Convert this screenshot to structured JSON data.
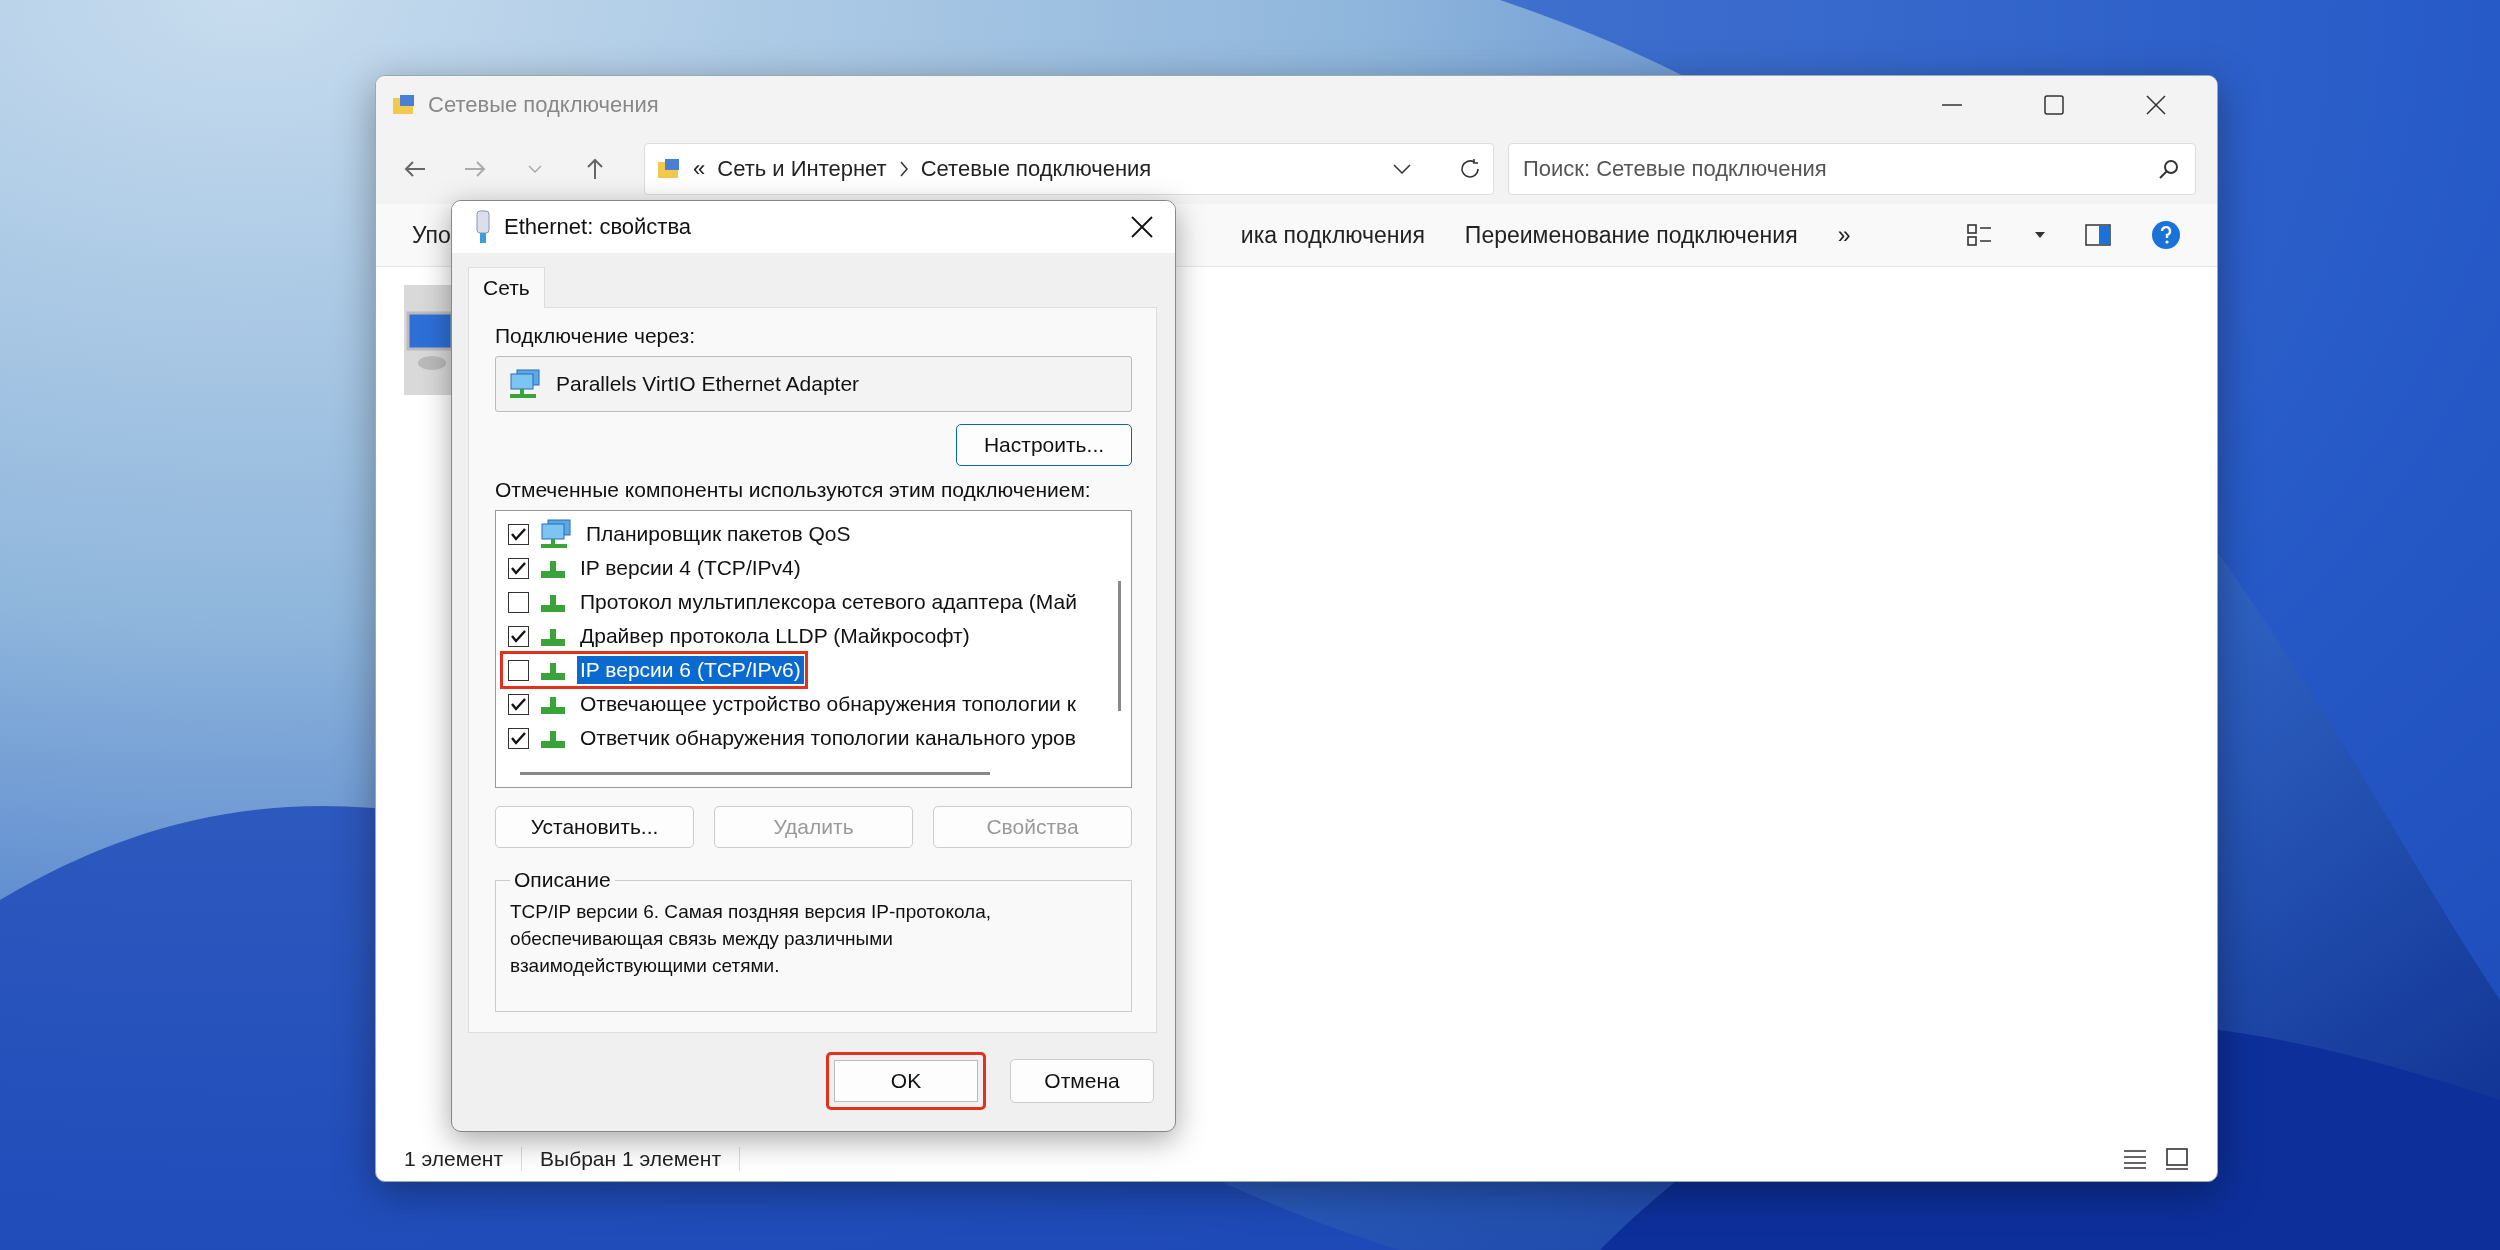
{
  "explorer": {
    "title": "Сетевые подключения",
    "breadcrumb": [
      "«",
      "Сеть и Интернет",
      "Сетевые подключения"
    ],
    "search": {
      "placeholder": "Поиск: Сетевые подключения"
    },
    "toolbar": [
      "Упо",
      "ика подключения",
      "Переименование подключения",
      "»"
    ],
    "status_bar": [
      "1 элемент",
      "Выбран 1 элемент"
    ]
  },
  "dialog": {
    "title": "Ethernet: свойства",
    "tabs": [
      {
        "label": "Сеть",
        "selected": true
      }
    ],
    "connect_label": "Подключение через:",
    "adapter": "Parallels VirtIO Ethernet Adapter",
    "configure_button": "Настроить...",
    "components_label": "Отмеченные компоненты используются этим подключением:",
    "components": [
      {
        "kind": "service",
        "label": "Планировщик пакетов QoS",
        "checked": true,
        "selected": false,
        "highlighted": false
      },
      {
        "kind": "protocol",
        "label": "IP версии 4 (TCP/IPv4)",
        "checked": true,
        "selected": false,
        "highlighted": false
      },
      {
        "kind": "protocol",
        "label": "Протокол мультиплексора сетевого адаптера (Май",
        "checked": false,
        "selected": false,
        "highlighted": false
      },
      {
        "kind": "protocol",
        "label": "Драйвер протокола LLDP (Майкрософт)",
        "checked": true,
        "selected": false,
        "highlighted": false
      },
      {
        "kind": "protocol",
        "label": "IP версии 6 (TCP/IPv6)",
        "checked": false,
        "selected": true,
        "highlighted": true
      },
      {
        "kind": "protocol",
        "label": "Отвечающее устройство обнаружения топологии к",
        "checked": true,
        "selected": false,
        "highlighted": false
      },
      {
        "kind": "protocol",
        "label": "Ответчик обнаружения топологии канального уров",
        "checked": true,
        "selected": false,
        "highlighted": false
      }
    ],
    "buttons": [
      {
        "label": "Установить...",
        "disabled": false
      },
      {
        "label": "Удалить",
        "disabled": true
      },
      {
        "label": "Свойства",
        "disabled": true
      }
    ],
    "description": {
      "title": "Описание",
      "text": "TCP/IP версии 6. Самая поздняя версия IP-протокола, обеспечивающая связь между различными взаимодействующими сетями."
    },
    "footer_buttons": [
      {
        "label": "OK",
        "highlighted": true
      },
      {
        "label": "Отмена",
        "highlighted": false
      }
    ]
  }
}
